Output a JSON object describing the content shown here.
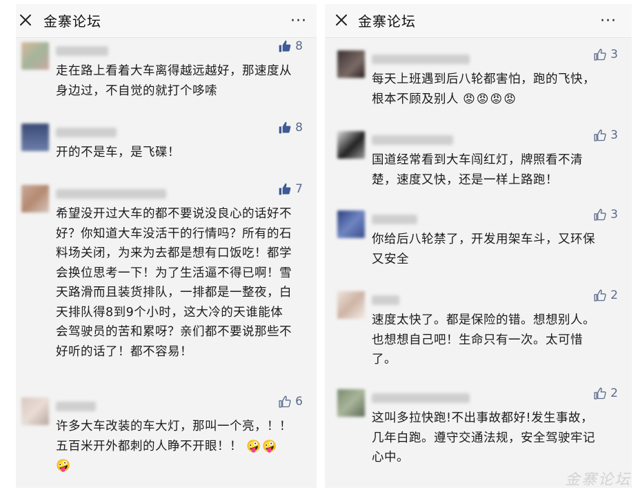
{
  "left_panel": {
    "title": "金寨论坛",
    "more": "···",
    "comments": [
      {
        "likes": "8",
        "text": "走在路上看着大车离得越远越好，那速度从身边过，不自觉的就打个哆嗦"
      },
      {
        "likes": "8",
        "text": "开的不是车，是飞碟！"
      },
      {
        "likes": "7",
        "text": "希望没开过大车的都不要说没良心的话好不好？你知道大车没活干的行情吗？所有的石料场关闭，为来为去都是想有口饭吃！都学会换位思考一下！为了生活逼不得已啊！雪天路滑而且装货排队，一排都是一整夜，白天排队得8到9个小时，这大冷的天谁能体会驾驶员的苦和累呀？亲们都不要说那些不好听的话了！都不容易！"
      },
      {
        "likes": "6",
        "text": "许多大车改装的车大灯，那叫一个亮，！！五百米开外都刺的人睁不开眼！！",
        "emoji": "🤪🤪🤪"
      }
    ]
  },
  "right_panel": {
    "title": "金寨论坛",
    "more": "···",
    "comments": [
      {
        "likes": "3",
        "text": "每天上班遇到后八轮都害怕，跑的飞快，根本不顾及别人",
        "emoji": "😡😡😡😡"
      },
      {
        "likes": "3",
        "text": "国道经常看到大车闯红灯，牌照看不清楚，速度又快，还是一样上路跑！"
      },
      {
        "likes": "3",
        "text": "你给后八轮禁了，开发用架车斗，又环保又安全"
      },
      {
        "likes": "2",
        "text": "速度太快了。都是保险的错。想想别人。也想想自己吧！生命只有一次。太可惜了。"
      },
      {
        "likes": "2",
        "text": "这叫多拉快跑!不出事故都好!发生事故，几年白跑。遵守交通法规，安全驾驶牢记心中。"
      }
    ]
  },
  "watermark": "金寨论坛",
  "icons": {
    "close": "close-icon",
    "more": "more-icon",
    "like": "thumbs-up-icon"
  },
  "colors": {
    "like_active": "#3e5a96",
    "like_outline": "#5a6b8c",
    "panel_bg": "#f3f3f3"
  }
}
